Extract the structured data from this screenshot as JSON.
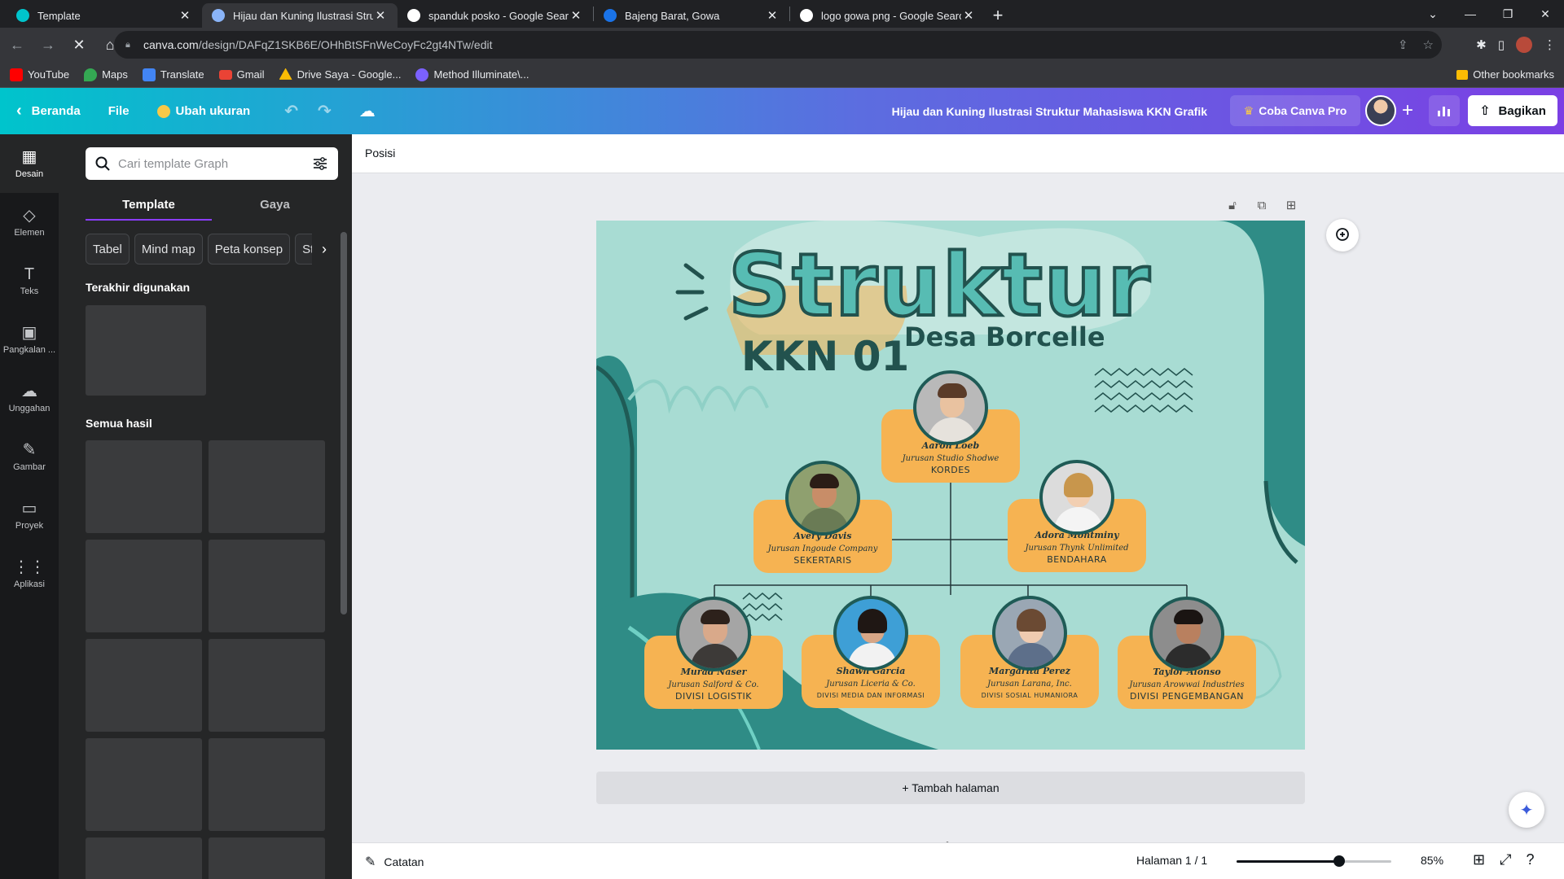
{
  "browser": {
    "tabs": [
      {
        "title": "Template",
        "color": "#00c4cc",
        "active": false
      },
      {
        "title": "Hijau dan Kuning Ilustrasi Struktu",
        "color": "#8ab4f8",
        "active": true
      },
      {
        "title": "spanduk posko - Google Search",
        "color": "#4285f4",
        "active": false
      },
      {
        "title": "Bajeng Barat, Gowa",
        "color": "#1a73e8",
        "active": false
      },
      {
        "title": "logo gowa png - Google Search",
        "color": "#4285f4",
        "active": false
      }
    ],
    "url_host": "canva.com",
    "url_path": "/design/DAFqZ1SKB6E/OHhBtSFnWeCoyFc2gt4NTw/edit",
    "bookmarks": [
      {
        "label": "YouTube",
        "color": "#ff0000"
      },
      {
        "label": "Maps",
        "color": "#34a853"
      },
      {
        "label": "Translate",
        "color": "#4285f4"
      },
      {
        "label": "Gmail",
        "color": "#ea4335"
      },
      {
        "label": "Drive Saya - Google...",
        "color": "#fbbc04"
      },
      {
        "label": "Method Illuminate\\...",
        "color": "#7b61ff"
      }
    ],
    "other_bookmarks": "Other bookmarks"
  },
  "header": {
    "back_label": "Beranda",
    "file_label": "File",
    "resize_label": "Ubah ukuran",
    "doc_title": "Hijau dan Kuning Ilustrasi Struktur Mahasiswa KKN Grafik",
    "pro_label": "Coba Canva Pro",
    "share_label": "Bagikan"
  },
  "rail": [
    {
      "label": "Desain",
      "icon": "▦",
      "active": true
    },
    {
      "label": "Elemen",
      "icon": "◇",
      "active": false
    },
    {
      "label": "Teks",
      "icon": "T",
      "active": false
    },
    {
      "label": "Pangkalan ...",
      "icon": "▣",
      "active": false
    },
    {
      "label": "Unggahan",
      "icon": "☁",
      "active": false
    },
    {
      "label": "Gambar",
      "icon": "✎",
      "active": false
    },
    {
      "label": "Proyek",
      "icon": "▭",
      "active": false
    },
    {
      "label": "Aplikasi",
      "icon": "⋮⋮",
      "active": false
    }
  ],
  "panel": {
    "search_placeholder": "Cari template Graph",
    "tabs": [
      "Template",
      "Gaya"
    ],
    "chips": [
      "Tabel",
      "Mind map",
      "Peta konsep",
      "Str"
    ],
    "recent_title": "Terakhir digunakan",
    "all_title": "Semua hasil"
  },
  "editor": {
    "context_label": "Posisi",
    "add_page": "+ Tambah halaman",
    "notes": "Catatan",
    "page_count": "Halaman 1 / 1",
    "zoom": "85%",
    "zoom_fraction": 0.85
  },
  "design": {
    "title": "Struktur",
    "kkn": "KKN 01",
    "desa": "Desa Borcelle",
    "members": [
      {
        "name": "Aaron Loeb",
        "dept": "Jurusan Studio Shodwe",
        "role": "KORDES",
        "skin": "#e9c2a0",
        "shirt": "#e6e2dc",
        "hair": "#5a3b28",
        "bg": "#b9b9b9"
      },
      {
        "name": "Avery Davis",
        "dept": "Jurusan Ingoude Company",
        "role": "SEKERTARIS",
        "skin": "#c88d68",
        "shirt": "#6a7b55",
        "hair": "#2b1d16",
        "bg": "#8fa06f"
      },
      {
        "name": "Adora Montminy",
        "dept": "Jurusan Thynk Unlimited",
        "role": "BENDAHARA",
        "skin": "#f2cfb2",
        "shirt": "#f4f4f4",
        "hair": "#c8964c",
        "bg": "#dcdcdc"
      },
      {
        "name": "Murad Naser",
        "dept": "Jurusan Salford & Co.",
        "role": "DIVISI LOGISTIK",
        "skin": "#d9a98a",
        "shirt": "#3d3a38",
        "hair": "#2d211b",
        "bg": "#a5a5a5"
      },
      {
        "name": "Shawn Garcia",
        "dept": "Jurusan Liceria & Co.",
        "role": "DIVISI MEDIA DAN INFORMASI",
        "skin": "#d7a686",
        "shirt": "#f2f2f2",
        "hair": "#1f1714",
        "bg": "#3e9fd6"
      },
      {
        "name": "Margarita Perez",
        "dept": "Jurusan Larana, Inc.",
        "role": "DIVISI SOSIAL HUMANIORA",
        "skin": "#f0cbb0",
        "shirt": "#5d6f8a",
        "hair": "#6b4a33",
        "bg": "#9aa7b4"
      },
      {
        "name": "Taylor Alonso",
        "dept": "Jurusan Arowwai Industries",
        "role": "DIVISI PENGEMBANGAN",
        "skin": "#b9805f",
        "shirt": "#2c2c2c",
        "hair": "#1a1412",
        "bg": "#8d8d8d"
      }
    ]
  }
}
